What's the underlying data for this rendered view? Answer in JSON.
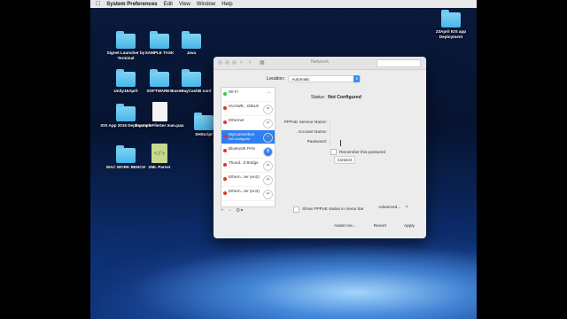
{
  "menubar": {
    "app": "System Preferences",
    "menus": [
      "Edit",
      "View",
      "Window",
      "Help"
    ]
  },
  "desktop": {
    "icons": [
      {
        "label": "Signet Launcher by Terminal",
        "kind": "folder"
      },
      {
        "label": "SAMPLE TASK",
        "kind": "folder"
      },
      {
        "label": "Java",
        "kind": "folder"
      },
      {
        "label": "Unity16April",
        "kind": "folder"
      },
      {
        "label": "SOFTWARES",
        "kind": "folder"
      },
      {
        "label": "EaseBayCashB oard",
        "kind": "folder"
      },
      {
        "label": "IOS App 2015 Deployment",
        "kind": "folder"
      },
      {
        "label": "ExampleFileGer man.pau",
        "kind": "document"
      },
      {
        "label": "SHScript",
        "kind": "folder"
      },
      {
        "label": "MAC WORK BENCH",
        "kind": "folder"
      },
      {
        "label": "XML Parser",
        "kind": "xml"
      },
      {
        "label": "23April IOS app Deployment",
        "kind": "folder"
      }
    ]
  },
  "window": {
    "title": "Network",
    "location_label": "Location:",
    "location_value": "Automatic",
    "services": [
      {
        "name": "Wi-Fi",
        "sub": "",
        "status_color": "#2ecc40",
        "icon": "wifi-icon"
      },
      {
        "name": "HUAWE...OBILE",
        "sub": "",
        "status_color": "#e0342c",
        "icon": "phone-icon"
      },
      {
        "name": "Ethernet",
        "sub": "",
        "status_color": "#e0342c",
        "icon": "ethernet-icon"
      },
      {
        "name": "MyConnection",
        "sub": "Not Configured",
        "status_color": "#e0342c",
        "icon": "phone-icon"
      },
      {
        "name": "Bluetooth PAN",
        "sub": "",
        "status_color": "#e0342c",
        "icon": "bluetooth-icon"
      },
      {
        "name": "Thund...lt Bridge",
        "sub": "",
        "status_color": "#e0342c",
        "icon": "ethernet-icon"
      },
      {
        "name": "Ethern...ter (en2)",
        "sub": "",
        "status_color": "#e0342c",
        "icon": "ethernet-icon"
      },
      {
        "name": "Ethern...ter (en3)",
        "sub": "",
        "status_color": "#e0342c",
        "icon": "ethernet-icon"
      }
    ],
    "status_label": "Status:",
    "status_value": "Not Configured",
    "form": {
      "service_name_label": "PPPoE Service Name:",
      "account_name_label": "Account Name:",
      "password_label": "Password:",
      "remember_label": "Remember this password",
      "connect_label": "Connect"
    },
    "show_pppoe_label": "Show PPPoE status in menu bar",
    "advanced_label": "Advanced...",
    "assist_label": "Assist me...",
    "revert_label": "Revert",
    "apply_label": "Apply"
  }
}
